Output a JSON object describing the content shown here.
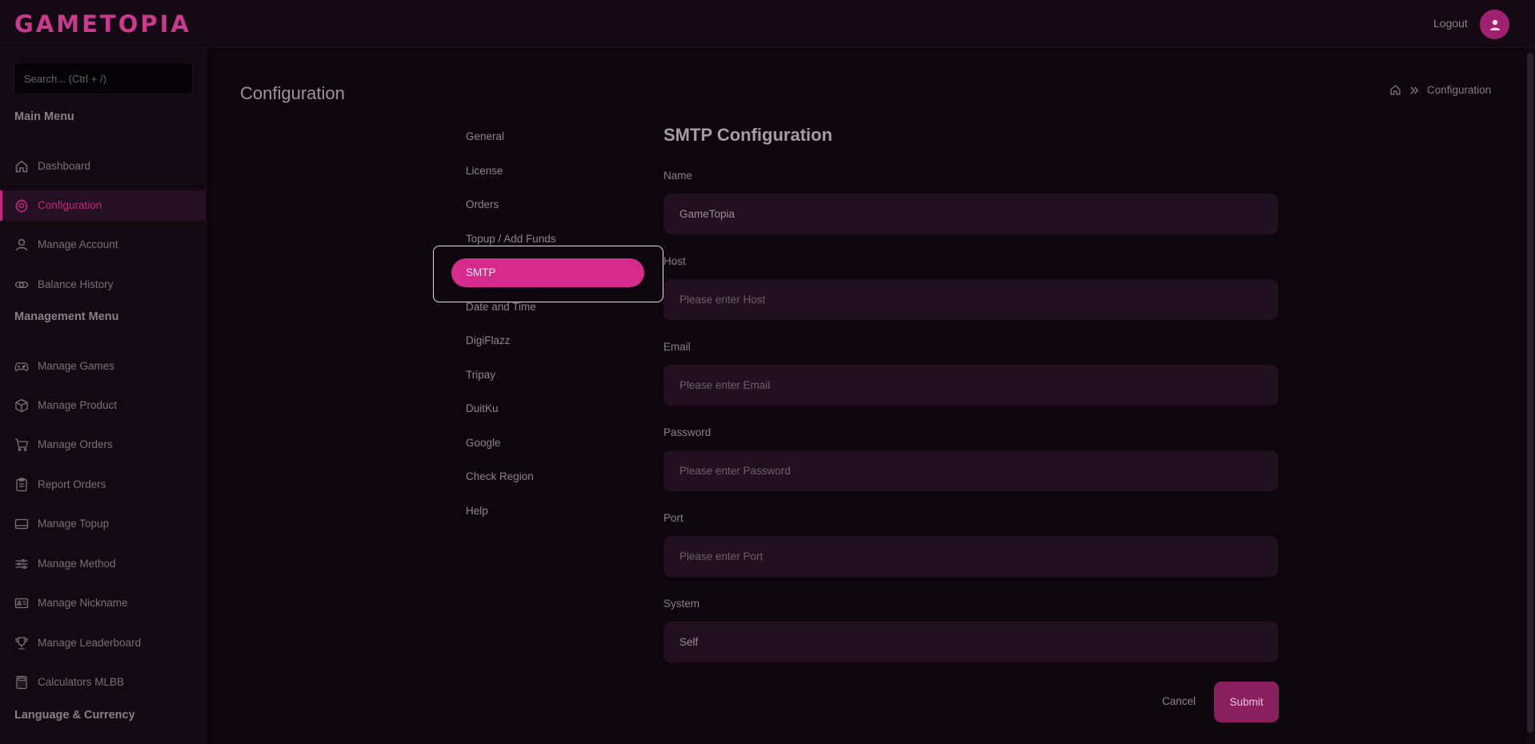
{
  "app": {
    "logo": "GAMETOPIA",
    "logout_label": "Logout"
  },
  "sidebar": {
    "search_placeholder": "Search... (Ctrl + /)",
    "main_menu_title": "Main Menu",
    "main_items": [
      {
        "label": "Dashboard",
        "icon": "home-icon"
      },
      {
        "label": "Configuration",
        "icon": "gear-icon"
      },
      {
        "label": "Manage Account",
        "icon": "user-icon"
      },
      {
        "label": "Balance History",
        "icon": "coins-icon"
      }
    ],
    "management_menu_title": "Management Menu",
    "management_items": [
      {
        "label": "Manage Games",
        "icon": "gamepad-icon"
      },
      {
        "label": "Manage Product",
        "icon": "box-icon"
      },
      {
        "label": "Manage Orders",
        "icon": "cart-icon"
      },
      {
        "label": "Report Orders",
        "icon": "clipboard-icon"
      },
      {
        "label": "Manage Topup",
        "icon": "card-icon"
      },
      {
        "label": "Manage Method",
        "icon": "sliders-icon"
      },
      {
        "label": "Manage Nickname",
        "icon": "id-card-icon"
      },
      {
        "label": "Manage Leaderboard",
        "icon": "trophy-icon"
      },
      {
        "label": "Calculators MLBB",
        "icon": "calculator-icon"
      }
    ],
    "language_title": "Language & Currency"
  },
  "page": {
    "title": "Configuration",
    "breadcrumb_current": "Configuration"
  },
  "config_nav": [
    "General",
    "License",
    "Orders",
    "Topup / Add Funds",
    "SMTP",
    "Date and Time",
    "DigiFlazz",
    "Tripay",
    "DuitKu",
    "Google",
    "Check Region",
    "Help"
  ],
  "form": {
    "title": "SMTP Configuration",
    "fields": [
      {
        "label": "Name",
        "value": "GameTopia",
        "placeholder": ""
      },
      {
        "label": "Host",
        "value": "",
        "placeholder": "Please enter Host"
      },
      {
        "label": "Email",
        "value": "",
        "placeholder": "Please enter Email"
      },
      {
        "label": "Password",
        "value": "",
        "placeholder": "Please enter Password"
      },
      {
        "label": "Port",
        "value": "",
        "placeholder": "Please enter Port"
      },
      {
        "label": "System",
        "value": "Self",
        "placeholder": ""
      }
    ],
    "cancel_label": "Cancel",
    "submit_label": "Submit"
  },
  "colors": {
    "accent": "#d62a8c",
    "logo": "#c83a8e",
    "background": "#0d070d",
    "field_bg": "#211020"
  }
}
